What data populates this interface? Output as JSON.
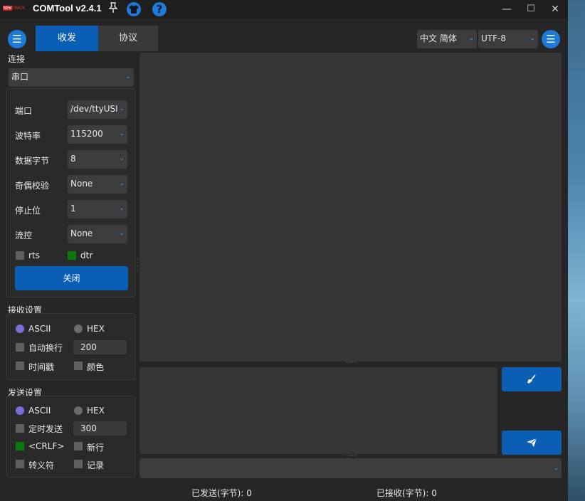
{
  "titlebar": {
    "logo_part1": "NEW",
    "logo_part2": "CRACK",
    "title": "COMTool v2.4.1",
    "icons": [
      "pin-icon",
      "skin-icon",
      "help-icon"
    ],
    "controls": {
      "minimize": "—",
      "maximize": "☐",
      "close": "✕"
    }
  },
  "tabs": [
    {
      "label": "收发",
      "active": true
    },
    {
      "label": "协议",
      "active": false
    }
  ],
  "top_right": {
    "language": "中文 简体",
    "encoding": "UTF-8"
  },
  "connection": {
    "section_label": "连接",
    "type": "串口",
    "fields": [
      {
        "label": "端口",
        "value": "/dev/ttyUSI"
      },
      {
        "label": "波特率",
        "value": "115200"
      },
      {
        "label": "数据字节",
        "value": "8"
      },
      {
        "label": "奇偶校验",
        "value": "None"
      },
      {
        "label": "停止位",
        "value": "1"
      },
      {
        "label": "流控",
        "value": "None"
      }
    ],
    "rts_label": "rts",
    "dtr_label": "dtr",
    "close_button": "关闭"
  },
  "receive": {
    "section_label": "接收设置",
    "ascii": "ASCII",
    "hex": "HEX",
    "auto_wrap": "自动换行",
    "auto_wrap_value": "200",
    "timestamp": "时间戳",
    "color": "颜色"
  },
  "send": {
    "section_label": "发送设置",
    "ascii": "ASCII",
    "hex": "HEX",
    "timed_send": "定时发送",
    "timed_value": "300",
    "crlf": "<CRLF>",
    "newline": "新行",
    "escape": "转义符",
    "record": "记录"
  },
  "status": {
    "sent": "已发送(字节): 0",
    "received": "已接收(字节): 0"
  },
  "colors": {
    "accent": "#0a5fb4",
    "checked": "#0a7a0a",
    "radio_on": "#7a6ed8"
  }
}
